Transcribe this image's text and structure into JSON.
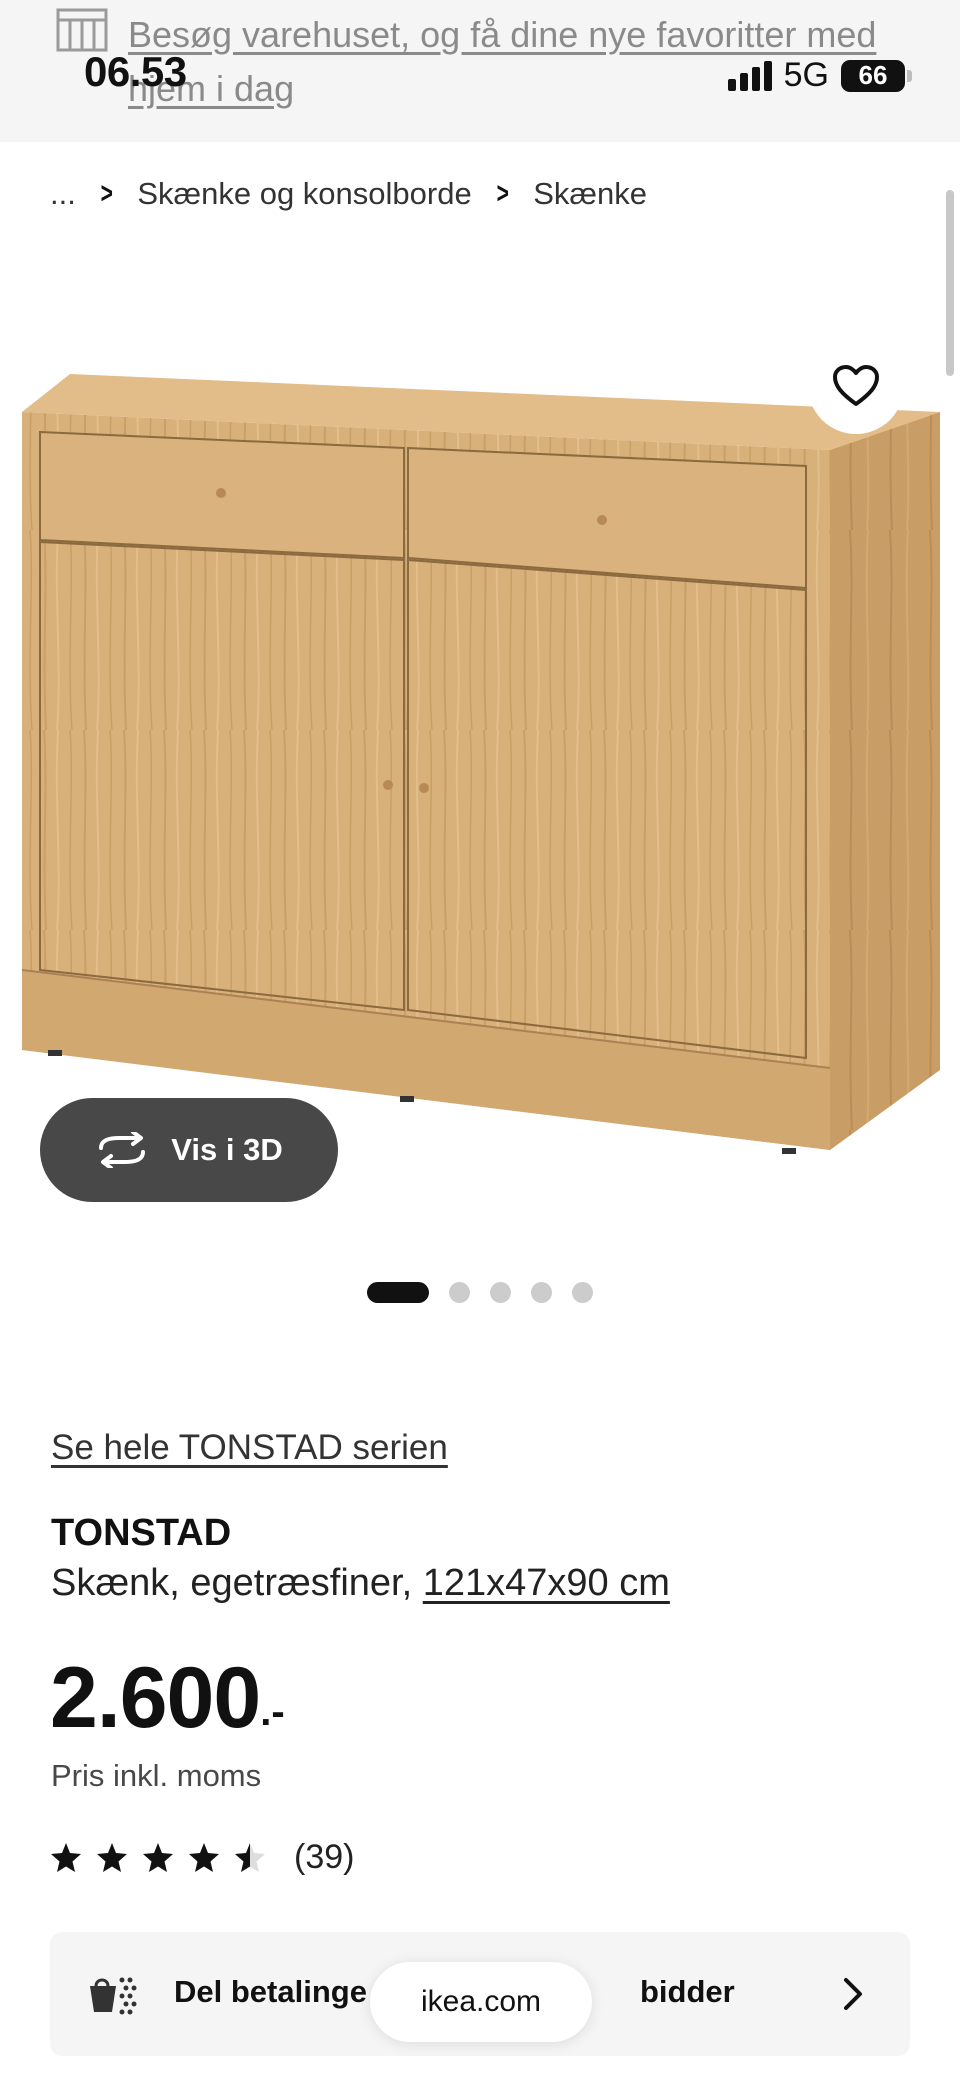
{
  "status_bar": {
    "time": "06.53",
    "network": "5G",
    "battery": "66"
  },
  "banner": {
    "icon": "store-icon",
    "text": "Besøg varehuset, og få dine nye favoritter med hjem i dag"
  },
  "breadcrumb": {
    "ellipsis": "...",
    "items": [
      "Skænke og konsolborde",
      "Skænke"
    ]
  },
  "gallery": {
    "three_d_label": "Vis i 3D",
    "dots_total": 5,
    "active_index": 0
  },
  "product": {
    "series_link": "Se hele TONSTAD serien",
    "name": "TONSTAD",
    "description": "Skænk, egetræsfiner,",
    "dimensions": "121x47x90 cm",
    "price": "2.600",
    "price_suffix": ".-",
    "vat_note": "Pris inkl. moms",
    "rating_stars": 4.5,
    "rating_count": "(39)"
  },
  "payment": {
    "label_left": "Del betalinge",
    "label_right": "bidder"
  },
  "browser": {
    "url": "ikea.com"
  },
  "colors": {
    "wood": "#d8b07a",
    "pill_dark": "#484848",
    "card_bg": "#f5f5f5"
  }
}
